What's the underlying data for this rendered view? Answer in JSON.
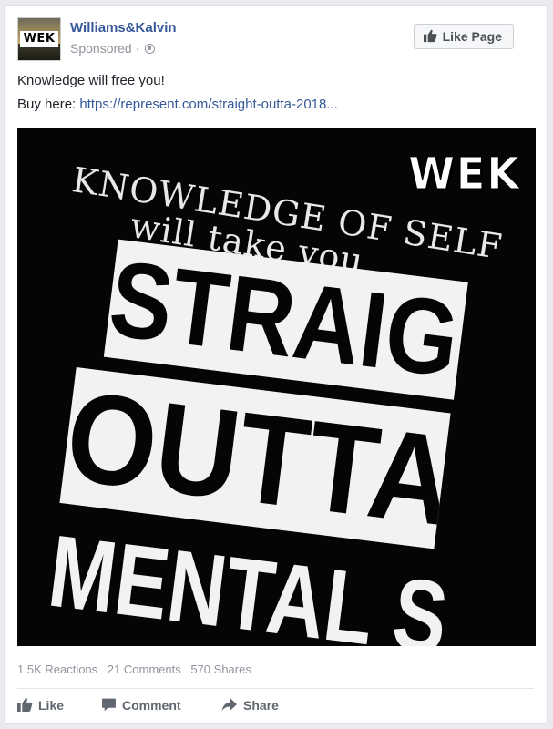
{
  "post": {
    "page_name": "Williams&Kalvin",
    "sponsored": "Sponsored",
    "dot": "·",
    "avatar_text": "WEK",
    "like_page_label": "Like Page",
    "text_line1": "Knowledge will free you!",
    "buy_prefix": "Buy here: ",
    "buy_link": "https://represent.com/straight-outta-2018..."
  },
  "image": {
    "logo": "WEK",
    "line1": "KNOWLEDGE OF SELF",
    "line2": "will take you",
    "bar1": "STRAIGHT",
    "bar2": "OUTTA",
    "bar3": "MENTAL SLAVERY"
  },
  "stats": {
    "reactions": "1.5K Reactions",
    "comments": "21 Comments",
    "shares": "570 Shares"
  },
  "actions": {
    "like": "Like",
    "comment": "Comment",
    "share": "Share"
  },
  "colors": {
    "link": "#365899",
    "muted": "#90949c",
    "button_bg": "#f6f7f9"
  },
  "icons": [
    "thumbs-up-icon",
    "globe-icon",
    "comment-icon",
    "share-icon"
  ]
}
